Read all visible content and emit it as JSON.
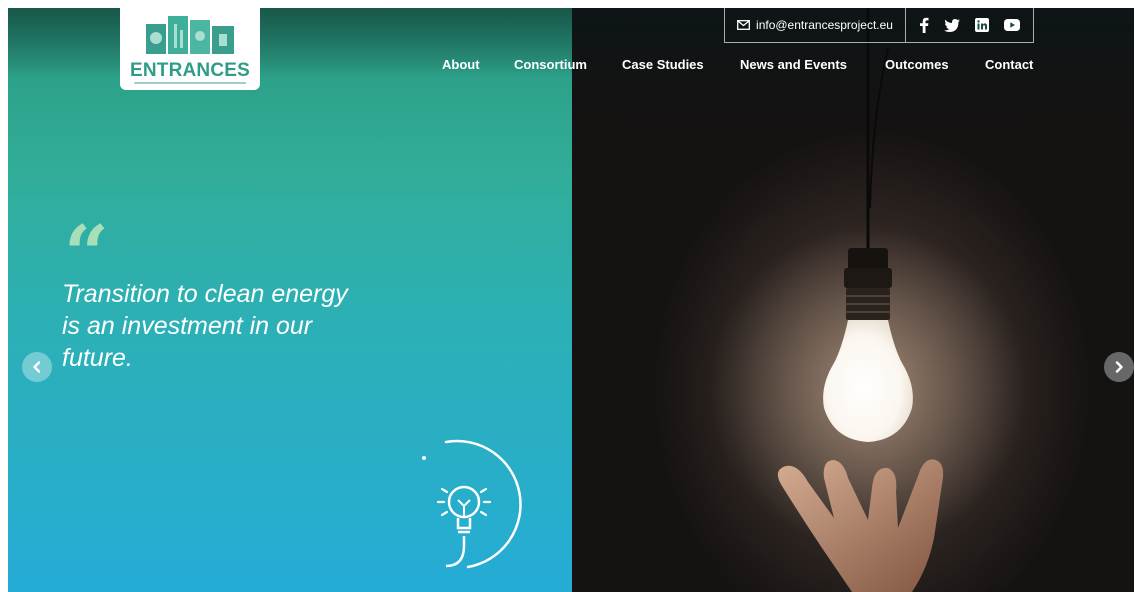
{
  "brand": {
    "name": "ENTRANCES"
  },
  "contact": {
    "email": "info@entrancesproject.eu"
  },
  "icons": {
    "email": "envelope-icon",
    "social": [
      "facebook-icon",
      "twitter-icon",
      "linkedin-icon",
      "youtube-icon"
    ],
    "prev": "chevron-left-icon",
    "next": "chevron-right-icon",
    "illustration": "lightbulb-icon"
  },
  "nav": {
    "items": [
      {
        "label": "About"
      },
      {
        "label": "Consortium"
      },
      {
        "label": "Case Studies"
      },
      {
        "label": "News and Events"
      },
      {
        "label": "Outcomes"
      },
      {
        "label": "Contact"
      }
    ]
  },
  "hero": {
    "quote_mark": "“",
    "quote_lines": [
      "Transition to clean energy",
      "is an investment in our",
      "future."
    ]
  },
  "colors": {
    "brand_green": "#2f9c8a",
    "quote_mark": "#a7dfb8",
    "panel_top": "#2da18a",
    "panel_bottom": "#25acd6"
  }
}
